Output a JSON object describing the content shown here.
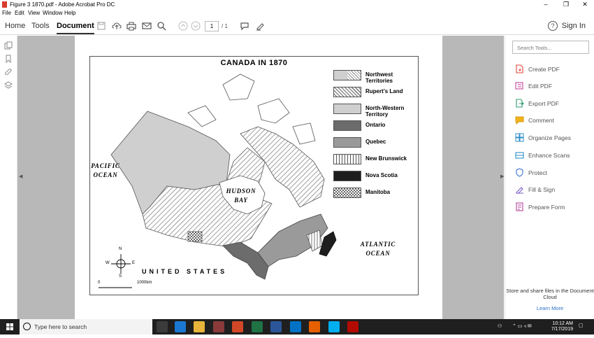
{
  "window": {
    "title": "Figure 3 1870.pdf - Adobe Acrobat Pro DC",
    "minimize": "–",
    "maximize": "❐",
    "close": "✕"
  },
  "menu": [
    "File",
    "Edit",
    "View",
    "Window",
    "Help"
  ],
  "toolbar": {
    "tabs": [
      "Home",
      "Tools",
      "Document"
    ],
    "active_tab": "Document",
    "page_current": "1",
    "page_total": "/ 1",
    "sign_in": "Sign In",
    "help": "?"
  },
  "map": {
    "title": "CANADA IN 1870",
    "legend": [
      {
        "label": "Northwest Territories",
        "pattern": "nwt"
      },
      {
        "label": "Rupert’s Land",
        "pattern": "hatch"
      },
      {
        "label": "North-Western Territory",
        "pattern": "light"
      },
      {
        "label": "Ontario",
        "pattern": "dark"
      },
      {
        "label": "Quebec",
        "pattern": "mid"
      },
      {
        "label": "New Brunswick",
        "pattern": "vert"
      },
      {
        "label": "Nova Scotia",
        "pattern": "black"
      },
      {
        "label": "Manitoba",
        "pattern": "check"
      }
    ],
    "pacific": "PACIFIC OCEAN",
    "hudson": "HUDSON BAY",
    "atlantic": "ATLANTIC OCEAN",
    "united_states": "UNITED STATES",
    "compass": {
      "n": "N",
      "s": "S",
      "e": "E",
      "w": "W"
    },
    "scale_start": "0",
    "scale_end": "1000km"
  },
  "right_pane": {
    "search_placeholder": "Search Tools...",
    "tools": [
      {
        "label": "Create PDF",
        "color": "#e0443b"
      },
      {
        "label": "Edit PDF",
        "color": "#c4459a"
      },
      {
        "label": "Export PDF",
        "color": "#2d9c6c"
      },
      {
        "label": "Comment",
        "color": "#f2b31b"
      },
      {
        "label": "Organize Pages",
        "color": "#2f8fc9"
      },
      {
        "label": "Enhance Scans",
        "color": "#2f8fc9"
      },
      {
        "label": "Protect",
        "color": "#3a6fd6"
      },
      {
        "label": "Fill & Sign",
        "color": "#7b5cc7"
      },
      {
        "label": "Prepare Form",
        "color": "#b1439a"
      }
    ],
    "cloud_text": "Store and share files in the Document Cloud",
    "learn_more": "Learn More"
  },
  "taskbar": {
    "search_placeholder": "Type here to search",
    "time": "10:12 AM",
    "date": "7/17/2019"
  }
}
